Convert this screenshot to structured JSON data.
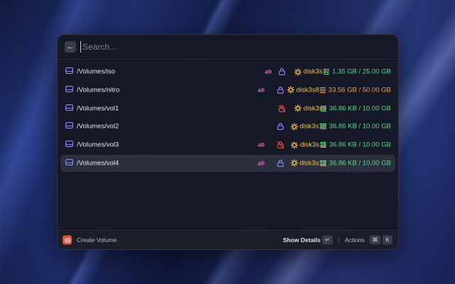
{
  "search": {
    "placeholder": "Search..."
  },
  "colors": {
    "ok": "#5fd28f",
    "warn": "#e6a156",
    "disk": "#f2c14e",
    "unlock": "#8c8ff5",
    "locked": "#e0524f",
    "ab": "#e072c8",
    "disk_icon": "#8c8ff5"
  },
  "volumes": [
    {
      "path": "/Volumes/iso",
      "ab": "ab",
      "lock": "unlocked",
      "disk": "disk3s7",
      "size": "1.35 GB / 25.00 GB",
      "size_status": "ok"
    },
    {
      "path": "/Volumes/nitro",
      "ab": "ab",
      "lock": "unlocked",
      "disk": "disk3s8",
      "size": "33.56 GB / 50.00 GB",
      "size_status": "warn"
    },
    {
      "path": "/Volumes/vol1",
      "ab": "",
      "lock": "locked",
      "disk": "disk3s9",
      "size": "36.86 KB / 10.00 GB",
      "size_status": "ok"
    },
    {
      "path": "/Volumes/vol2",
      "ab": "",
      "lock": "unlocked",
      "disk": "disk3s10",
      "size": "36.86 KB / 10.00 GB",
      "size_status": "ok"
    },
    {
      "path": "/Volumes/vol3",
      "ab": "ab",
      "lock": "locked",
      "disk": "disk3s11",
      "size": "36.86 KB / 10.00 GB",
      "size_status": "ok"
    },
    {
      "path": "/Volumes/vol4",
      "ab": "ab",
      "lock": "unlocked",
      "disk": "disk3s12",
      "size": "36.86 KB / 10.00 GB",
      "size_status": "ok",
      "selected": true
    }
  ],
  "footer": {
    "primary_action": "Create Volume",
    "show_details": "Show Details",
    "enter_key": "↵",
    "actions_label": "Actions",
    "cmd_key": "⌘",
    "k_key": "K"
  }
}
